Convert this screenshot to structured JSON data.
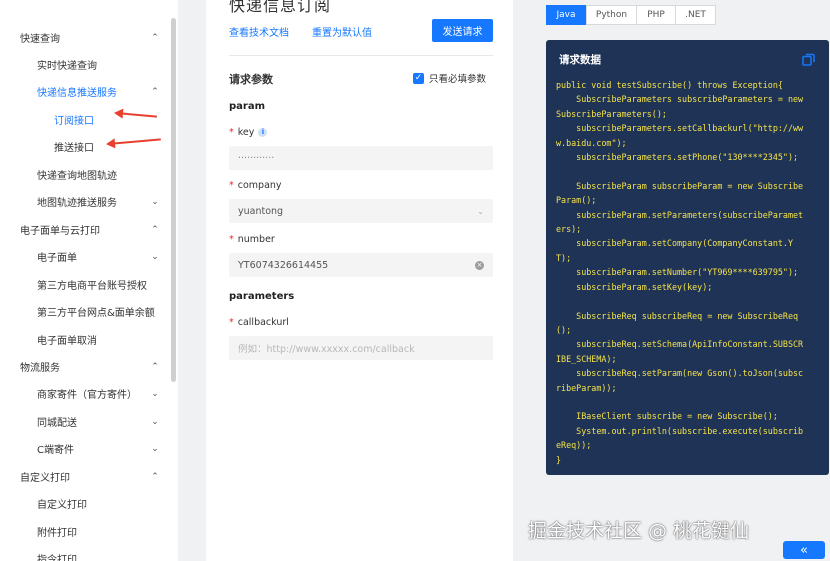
{
  "sidebar": {
    "items": [
      {
        "label": "快速查询",
        "chevron": "⌃"
      },
      {
        "label": "实时快递查询"
      },
      {
        "label": "快递信息推送服务",
        "chevron": "⌃"
      },
      {
        "label": "订阅接口"
      },
      {
        "label": "推送接口"
      },
      {
        "label": "快递查询地图轨迹"
      },
      {
        "label": "地图轨迹推送服务",
        "chevron": "⌄"
      },
      {
        "label": "电子面单与云打印",
        "chevron": "⌃"
      },
      {
        "label": "电子面单",
        "chevron": "⌄"
      },
      {
        "label": "第三方电商平台账号授权"
      },
      {
        "label": "第三方平台网点&面单余额"
      },
      {
        "label": "电子面单取消"
      },
      {
        "label": "物流服务",
        "chevron": "⌃"
      },
      {
        "label": "商家寄件（官方寄件）",
        "chevron": "⌄"
      },
      {
        "label": "同城配送",
        "chevron": "⌄"
      },
      {
        "label": "C端寄件",
        "chevron": "⌄"
      },
      {
        "label": "自定义打印",
        "chevron": "⌃"
      },
      {
        "label": "自定义打印"
      },
      {
        "label": "附件打印"
      },
      {
        "label": "指令打印"
      }
    ]
  },
  "form": {
    "title": "快递信息订阅",
    "doc_link": "查看技术文档",
    "reset_link": "重置为默认值",
    "send_button": "发送请求",
    "section_title": "请求参数",
    "required_only": "只看必填参数",
    "param_group": "param",
    "parameters_group": "parameters",
    "fields": {
      "key": {
        "label": "key",
        "value": "············"
      },
      "company": {
        "label": "company",
        "value": "yuantong"
      },
      "number": {
        "label": "number",
        "value": "YT6074326614455"
      },
      "callbackurl": {
        "label": "callbackurl",
        "placeholder": "例如：http://www.xxxxx.com/callback"
      }
    }
  },
  "code": {
    "tabs": [
      "Java",
      "Python",
      "PHP",
      ".NET"
    ],
    "active_tab": "Java",
    "title": "请求数据",
    "lines": [
      "public void testSubscribe() throws Exception{",
      "    SubscribeParameters subscribeParameters = new",
      "SubscribeParameters();",
      "    subscribeParameters.setCallbackurl(\"http://ww",
      "w.baidu.com\");",
      "    subscribeParameters.setPhone(\"130****2345\");",
      "",
      "    SubscribeParam subscribeParam = new Subscribe",
      "Param();",
      "    subscribeParam.setParameters(subscribeParamet",
      "ers);",
      "    subscribeParam.setCompany(CompanyConstant.Y",
      "T);",
      "    subscribeParam.setNumber(\"YT969****639795\");",
      "    subscribeParam.setKey(key);",
      "",
      "    SubscribeReq subscribeReq = new SubscribeReq",
      "();",
      "    subscribeReq.setSchema(ApiInfoConstant.SUBSCR",
      "IBE_SCHEMA);",
      "    subscribeReq.setParam(new Gson().toJson(subsc",
      "ribeParam));",
      "",
      "    IBaseClient subscribe = new Subscribe();",
      "    System.out.println(subscribe.execute(subscrib",
      "eReq));",
      "}"
    ]
  },
  "watermark": "掘金技术社区 @ 桃花键仙",
  "collapse_button": "«",
  "icons": {
    "copy": "copy-icon",
    "clear": "clear-icon",
    "chevron_up": "chevron-up-icon",
    "chevron_down": "chevron-down-icon",
    "info": "info-icon",
    "arrow": "red-arrow"
  },
  "colors": {
    "accent": "#1677ff",
    "code_bg": "#1e3356",
    "code_text": "#f5e34a",
    "required": "#f5222d",
    "annotation": "#e8402f"
  }
}
